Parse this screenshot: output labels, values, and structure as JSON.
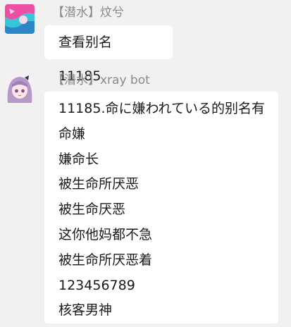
{
  "messages": [
    {
      "sender": "【潜水】炆兮",
      "avatar": "user-avatar",
      "lines": [
        "查看别名 11185"
      ]
    },
    {
      "sender": "【潜水】xray bot",
      "avatar": "bot-avatar",
      "lines": [
        "11185.命に嫌われている的别名有",
        "命嫌",
        "嫌命长",
        "被生命所厌恶",
        "被生命厌恶",
        "这你他妈都不急",
        "被生命所厌恶着",
        "123456789",
        "核客男神"
      ]
    }
  ],
  "colors": {
    "background": "#f1f1f1",
    "bubble": "#ffffff",
    "sender_text": "#8a8a8a",
    "message_text": "#1a1a1a"
  }
}
